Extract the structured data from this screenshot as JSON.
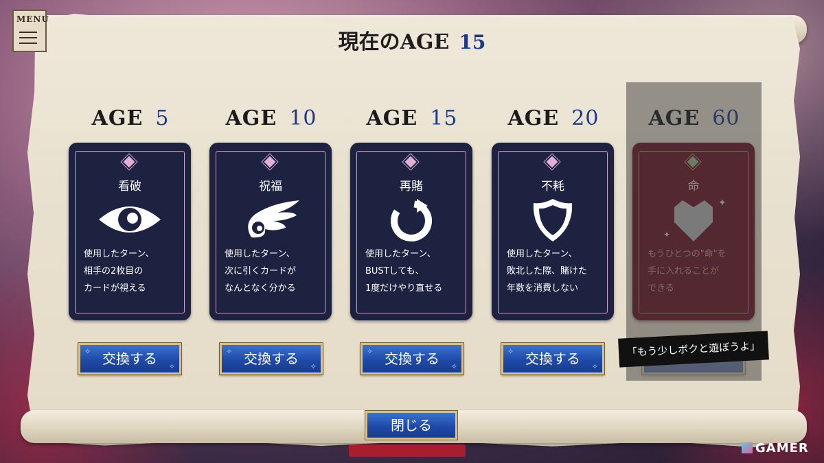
{
  "menu": {
    "label": "MENU"
  },
  "header": {
    "title": "現在のAGE",
    "current_age": "15"
  },
  "cards": [
    {
      "age_prefix": "AGE",
      "age": "5",
      "name": "看破",
      "icon": "eye-icon",
      "desc": [
        "使用したターン、",
        "相手の2枚目の",
        "カードが視える"
      ],
      "button": "交換する"
    },
    {
      "age_prefix": "AGE",
      "age": "10",
      "name": "祝福",
      "icon": "wing-icon",
      "desc": [
        "使用したターン、",
        "次に引くカードが",
        "なんとなく分かる"
      ],
      "button": "交換する"
    },
    {
      "age_prefix": "AGE",
      "age": "15",
      "name": "再賭",
      "icon": "retry-icon",
      "desc": [
        "使用したターン、",
        "BUSTしても、",
        "1度だけやり直せる"
      ],
      "button": "交換する"
    },
    {
      "age_prefix": "AGE",
      "age": "20",
      "name": "不耗",
      "icon": "shield-icon",
      "desc": [
        "使用したターン、",
        "敗北した際、賭けた",
        "年数を消費しない"
      ],
      "button": "交換する"
    },
    {
      "age_prefix": "AGE",
      "age": "60",
      "name": "命",
      "icon": "heart-icon",
      "desc": [
        "もうひとつの\"命\"を",
        "手に入れることが",
        "できる"
      ],
      "button": ""
    }
  ],
  "speech": "「もう少しボクと遊ぼうよ」",
  "close_button": "閉じる",
  "watermark": "GAMER",
  "colors": {
    "card_bg": "#1d2240",
    "locked_card_bg": "#6a1424",
    "button_blue": "#1f4aa8",
    "age_number": "#1c3a8c"
  }
}
